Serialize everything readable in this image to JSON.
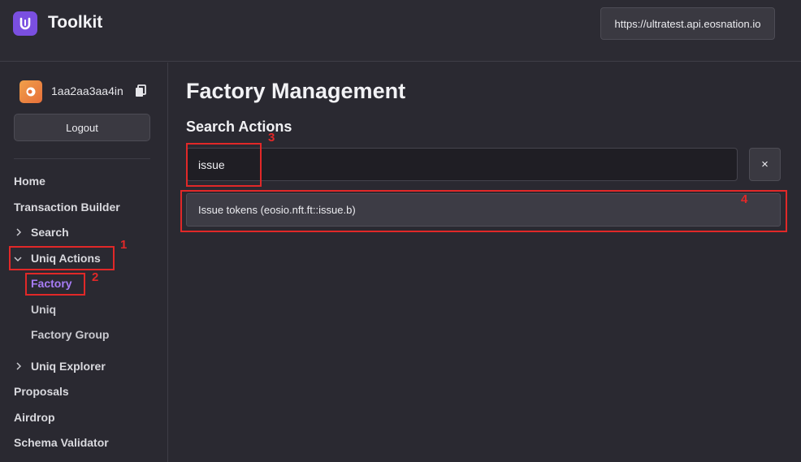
{
  "app": {
    "title": "Toolkit",
    "logo_letter": "U",
    "logo_color": "#7a4fe0"
  },
  "header": {
    "endpoint": "https://ultratest.api.eosnation.io"
  },
  "sidebar": {
    "account": "1aa2aa3aa4in",
    "logout_label": "Logout",
    "nav": {
      "home": "Home",
      "transaction_builder": "Transaction Builder",
      "search": "Search",
      "uniq_actions": "Uniq Actions",
      "factory": "Factory",
      "uniq": "Uniq",
      "factory_group": "Factory Group",
      "uniq_explorer": "Uniq Explorer",
      "proposals": "Proposals",
      "airdrop": "Airdrop",
      "schema_validator": "Schema Validator"
    },
    "active_color": "#a77cf5"
  },
  "main": {
    "title": "Factory Management",
    "section_title": "Search Actions",
    "search_value": "issue",
    "clear_label": "×",
    "results": [
      "Issue tokens (eosio.nft.ft::issue.b)"
    ]
  },
  "annotations": {
    "n1": "1",
    "n2": "2",
    "n3": "3",
    "n4": "4",
    "color": "#e12828"
  }
}
